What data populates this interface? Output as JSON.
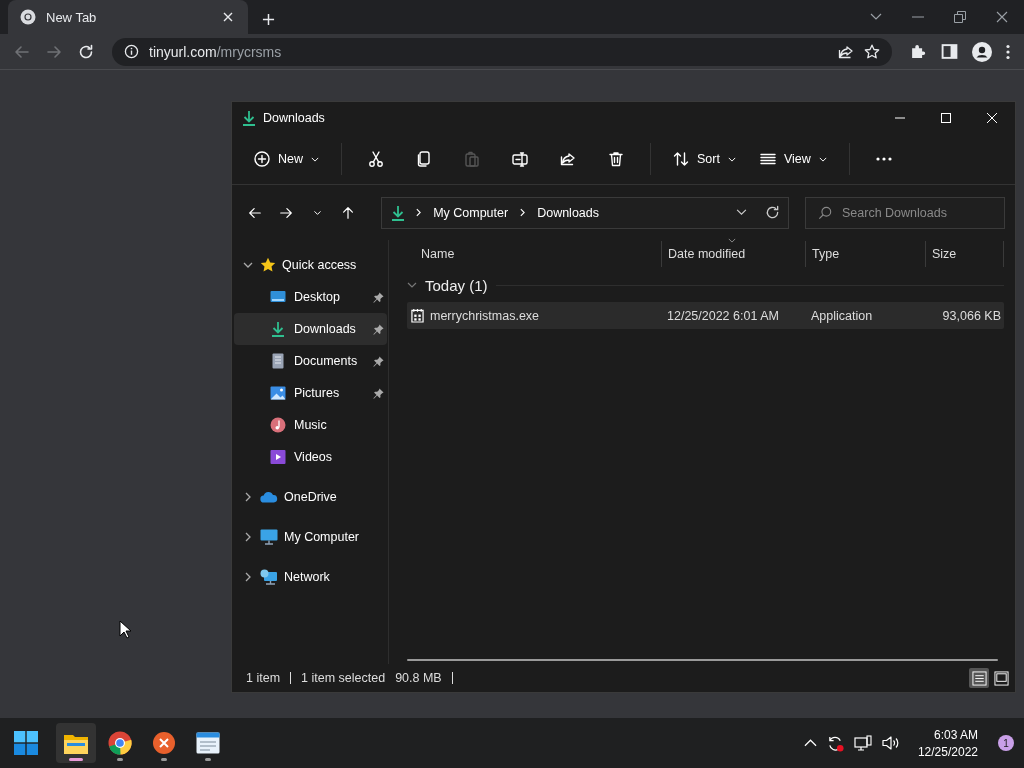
{
  "browser": {
    "tab": {
      "title": "New Tab"
    },
    "address": {
      "host": "tinyurl.com",
      "path": "/mrycrsms"
    },
    "nav": {
      "back_disabled": true,
      "forward_disabled": true
    }
  },
  "explorer": {
    "title": "Downloads",
    "commands": [
      {
        "kind": "new",
        "label": "New",
        "disabled": false
      },
      {
        "kind": "cut",
        "disabled": false
      },
      {
        "kind": "copy",
        "disabled": false
      },
      {
        "kind": "paste",
        "disabled": true
      },
      {
        "kind": "rename",
        "disabled": false
      },
      {
        "kind": "share",
        "disabled": false
      },
      {
        "kind": "delete",
        "disabled": false
      },
      {
        "kind": "sort",
        "label": "Sort",
        "disabled": false
      },
      {
        "kind": "view",
        "label": "View",
        "disabled": false
      },
      {
        "kind": "more",
        "disabled": false
      }
    ],
    "breadcrumb": [
      "My Computer",
      "Downloads"
    ],
    "search": {
      "placeholder": "Search Downloads"
    },
    "sidebar": {
      "items": [
        {
          "kind": "star",
          "label": "Quick access",
          "expanded": true,
          "selected": false,
          "children": [
            {
              "kind": "desktop",
              "label": "Desktop",
              "pinned": true,
              "selected": false
            },
            {
              "kind": "downloads",
              "label": "Downloads",
              "pinned": true,
              "selected": true
            },
            {
              "kind": "documents",
              "label": "Documents",
              "pinned": true,
              "selected": false
            },
            {
              "kind": "pictures",
              "label": "Pictures",
              "pinned": true,
              "selected": false
            },
            {
              "kind": "music",
              "label": "Music",
              "pinned": false,
              "selected": false
            },
            {
              "kind": "videos",
              "label": "Videos",
              "pinned": false,
              "selected": false
            }
          ]
        },
        {
          "kind": "cloud",
          "label": "OneDrive",
          "expanded": false,
          "selected": false
        },
        {
          "kind": "computer",
          "label": "My Computer",
          "expanded": false,
          "selected": false
        },
        {
          "kind": "network",
          "label": "Network",
          "expanded": false,
          "selected": false
        }
      ]
    },
    "table": {
      "columns": [
        {
          "label": "Name",
          "sorted": false
        },
        {
          "label": "Date modified",
          "sorted": true
        },
        {
          "label": "Type",
          "sorted": false
        },
        {
          "label": "Size",
          "sorted": false
        }
      ],
      "groups": [
        {
          "label": "Today (1)",
          "expanded": true,
          "rows": [
            {
              "name": "merrychristmas.exe",
              "date": "12/25/2022 6:01 AM",
              "type": "Application",
              "size": "93,066 KB",
              "selected": true
            }
          ]
        }
      ]
    },
    "status_bar": {
      "count": "1 item",
      "selection": "1 item selected",
      "selection_size": "90.8 MB",
      "views": [
        {
          "kind": "details",
          "selected": true
        },
        {
          "kind": "tiles",
          "selected": false
        }
      ]
    }
  },
  "taskbar": {
    "apps": [
      {
        "kind": "start",
        "running": false,
        "active": false
      },
      {
        "kind": "explorer",
        "running": true,
        "active": true
      },
      {
        "kind": "chrome",
        "running": true,
        "active": false
      },
      {
        "kind": "xapp",
        "running": true,
        "active": false
      },
      {
        "kind": "notepad",
        "running": true,
        "active": false
      }
    ],
    "time": "6:03 AM",
    "date": "12/25/2022",
    "notifications": "1"
  }
}
